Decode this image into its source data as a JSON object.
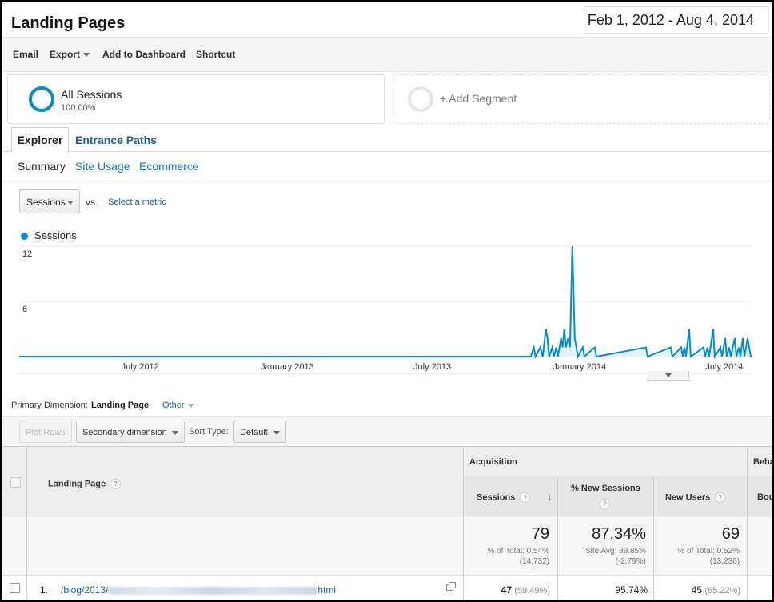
{
  "page": {
    "title": "Landing Pages",
    "date_range": "Feb 1, 2012 - Aug 4, 2014"
  },
  "toolbar": {
    "email": "Email",
    "export": "Export",
    "add_dashboard": "Add to Dashboard",
    "shortcut": "Shortcut"
  },
  "segments": {
    "active": {
      "name": "All Sessions",
      "pct": "100.00%"
    },
    "add": "+ Add Segment"
  },
  "tabs": {
    "explorer": "Explorer",
    "entrance_paths": "Entrance Paths"
  },
  "subtabs": {
    "summary": "Summary",
    "site_usage": "Site Usage",
    "ecommerce": "Ecommerce"
  },
  "chart_controls": {
    "metric": "Sessions",
    "vs": "vs.",
    "select_metric": "Select a metric",
    "legend": "Sessions"
  },
  "colors": {
    "series": "#058dc7",
    "link": "#1a5fa2"
  },
  "chart_data": {
    "type": "line",
    "series": [
      {
        "name": "Sessions",
        "color": "#058dc7"
      }
    ],
    "x_ticks": [
      "July 2012",
      "January 2013",
      "July 2013",
      "January 2014",
      "July 2014"
    ],
    "y_ticks": [
      "12",
      "6"
    ],
    "ylim": [
      0,
      12
    ],
    "x_range": [
      "2012-02-01",
      "2014-08-04"
    ],
    "points": [
      [
        "2013-11-01",
        0
      ],
      [
        "2013-11-05",
        1
      ],
      [
        "2013-11-07",
        0
      ],
      [
        "2013-11-13",
        1
      ],
      [
        "2013-11-16",
        0
      ],
      [
        "2013-11-20",
        3
      ],
      [
        "2013-11-22",
        2
      ],
      [
        "2013-11-24",
        0
      ],
      [
        "2013-11-28",
        1
      ],
      [
        "2013-11-30",
        0
      ],
      [
        "2013-12-03",
        1
      ],
      [
        "2013-12-05",
        0
      ],
      [
        "2013-12-09",
        2
      ],
      [
        "2013-12-11",
        1
      ],
      [
        "2013-12-13",
        3
      ],
      [
        "2013-12-15",
        1
      ],
      [
        "2013-12-18",
        2
      ],
      [
        "2013-12-20",
        1
      ],
      [
        "2013-12-23",
        12
      ],
      [
        "2013-12-26",
        2
      ],
      [
        "2013-12-28",
        1
      ],
      [
        "2013-12-30",
        0
      ],
      [
        "2014-01-05",
        1
      ],
      [
        "2014-01-07",
        0
      ],
      [
        "2014-01-20",
        1
      ],
      [
        "2014-01-22",
        0
      ],
      [
        "2014-03-25",
        1
      ],
      [
        "2014-03-27",
        0
      ],
      [
        "2014-04-25",
        1
      ],
      [
        "2014-04-27",
        0
      ],
      [
        "2014-05-08",
        1
      ],
      [
        "2014-05-10",
        0
      ],
      [
        "2014-05-12",
        1
      ],
      [
        "2014-05-14",
        0
      ],
      [
        "2014-05-18",
        3
      ],
      [
        "2014-05-20",
        0
      ],
      [
        "2014-06-05",
        1
      ],
      [
        "2014-06-07",
        0
      ],
      [
        "2014-06-10",
        1
      ],
      [
        "2014-06-12",
        0
      ],
      [
        "2014-06-17",
        3
      ],
      [
        "2014-06-19",
        0
      ],
      [
        "2014-06-26",
        1
      ],
      [
        "2014-06-28",
        0
      ],
      [
        "2014-07-02",
        2
      ],
      [
        "2014-07-04",
        0
      ],
      [
        "2014-07-07",
        1
      ],
      [
        "2014-07-09",
        0
      ],
      [
        "2014-07-14",
        2
      ],
      [
        "2014-07-16",
        0
      ],
      [
        "2014-07-19",
        1
      ],
      [
        "2014-07-21",
        0
      ],
      [
        "2014-07-24",
        2
      ],
      [
        "2014-07-26",
        0
      ],
      [
        "2014-07-28",
        1
      ],
      [
        "2014-07-30",
        2
      ],
      [
        "2014-08-01",
        1
      ],
      [
        "2014-08-03",
        0
      ]
    ]
  },
  "dimension": {
    "label": "Primary Dimension:",
    "value": "Landing Page",
    "other": "Other"
  },
  "controls": {
    "plot_rows": "Plot Rows",
    "secondary": "Secondary dimension",
    "sort_label": "Sort Type:",
    "sort_value": "Default"
  },
  "table": {
    "group_acquisition": "Acquisition",
    "group_behavior": "Beha",
    "col_landing": "Landing Page",
    "col_sessions": "Sessions",
    "col_new_sessions": "% New Sessions",
    "col_new_users": "New Users",
    "col_bounce": "Bou",
    "help": "?",
    "totals": {
      "sessions": "79",
      "sessions_sub1": "% of Total: 0.54%",
      "sessions_sub2": "(14,732)",
      "new_sessions": "87.34%",
      "new_sessions_sub1": "Site Avg: 89.85%",
      "new_sessions_sub2": "(-2.79%)",
      "new_users": "69",
      "new_users_sub1": "% of Total: 0.52%",
      "new_users_sub2": "(13,236)"
    },
    "rows": [
      {
        "index": "1.",
        "path_prefix": "/blog/2013/",
        "path_suffix": "html",
        "sessions": "47",
        "sessions_pct": "(59.49%)",
        "new_sessions": "95.74%",
        "new_users": "45",
        "new_users_pct": "(65.22%)"
      }
    ]
  }
}
